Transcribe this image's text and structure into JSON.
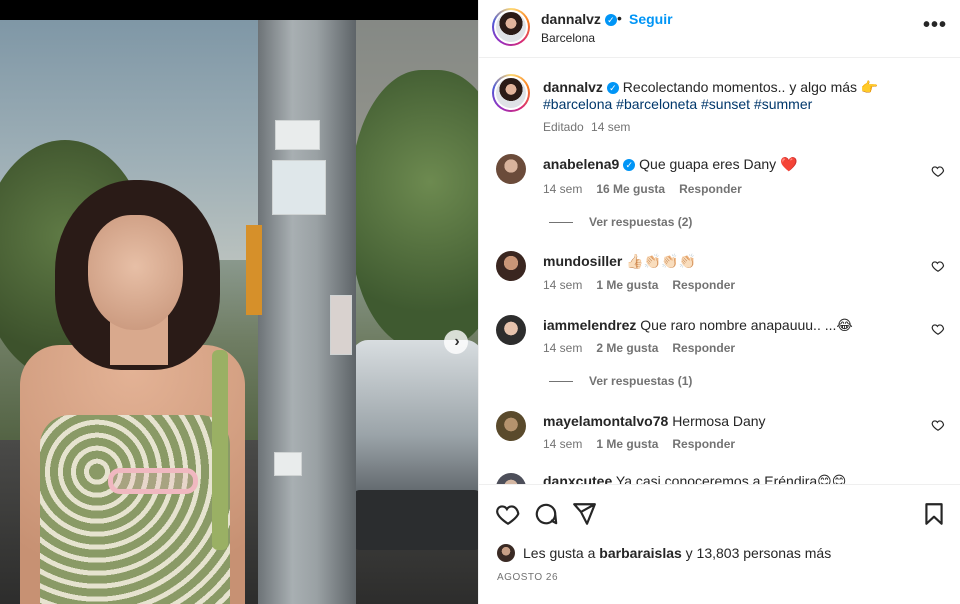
{
  "post": {
    "author": "dannalvz",
    "follow_label": "Seguir",
    "dot": "•",
    "location": "Barcelona",
    "more": "•••",
    "carousel_next": "›"
  },
  "caption": {
    "author": "dannalvz",
    "text": "Recolectando momentos.. y algo más 👉",
    "hashtags": "#barcelona #barceloneta #sunset #summer",
    "edited": "Editado",
    "time": "14 sem"
  },
  "comments": [
    {
      "user": "anabelena9",
      "verified": true,
      "text": "Que guapa eres Dany ❤️",
      "time": "14 sem",
      "likes": "16 Me gusta",
      "reply": "Responder",
      "replies": "Ver respuestas (2)"
    },
    {
      "user": "mundosiller",
      "verified": false,
      "text": "👍🏻👏🏻👏🏻👏🏻",
      "time": "14 sem",
      "likes": "1 Me gusta",
      "reply": "Responder",
      "replies": ""
    },
    {
      "user": "iammelendrez",
      "verified": false,
      "text": "Que raro nombre anapauuu.. ...😂",
      "time": "14 sem",
      "likes": "2 Me gusta",
      "reply": "Responder",
      "replies": "Ver respuestas (1)"
    },
    {
      "user": "mayelamontalvo78",
      "verified": false,
      "text": "Hermosa Dany",
      "time": "14 sem",
      "likes": "1 Me gusta",
      "reply": "Responder",
      "replies": ""
    },
    {
      "user": "danxcutee",
      "verified": false,
      "text": "Ya casi conoceremos a Eréndira😊😊",
      "time": "",
      "likes": "",
      "reply": "",
      "replies": ""
    }
  ],
  "likes": {
    "prefix": "Les gusta a",
    "user": "barbaraislas",
    "suffix": "y 13,803 personas más"
  },
  "date": "AGOSTO 26",
  "colors": {
    "accent": "#0095f6",
    "heart_red": "#ed4956",
    "hashtag": "#00376b"
  },
  "icons": [
    "like-icon",
    "comment-icon",
    "share-icon",
    "save-icon",
    "heart-icon",
    "verified-icon",
    "more-icon"
  ]
}
